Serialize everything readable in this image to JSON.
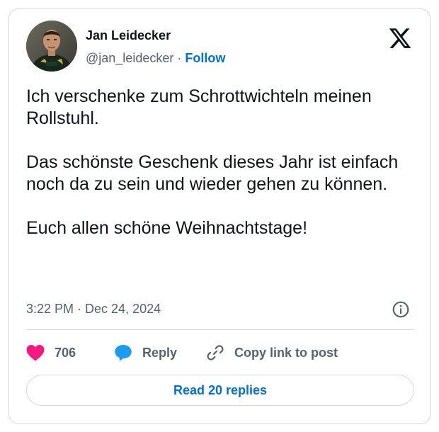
{
  "author": {
    "name": "Jan Leidecker",
    "handle": "@jan_leidecker",
    "separator": "·",
    "follow_label": "Follow"
  },
  "icons": {
    "brand": "x-logo-icon",
    "info": "info-icon",
    "like": "heart-icon",
    "reply": "speech-bubble-icon",
    "copy": "link-icon"
  },
  "tweet": {
    "paragraphs": [
      "Ich verschenke zum Schrottwichteln meinen Rollstuhl.",
      "Das schönste Geschenk dieses Jahr ist einfach noch da zu sein und wieder gehen zu können.",
      "Euch allen schöne Weihnachtstage!"
    ],
    "timestamp": "3:22 PM · Dec 24, 2024"
  },
  "actions": {
    "like_count": "706",
    "reply_label": "Reply",
    "copy_label": "Copy link to post"
  },
  "footer": {
    "read_replies_label": "Read 20 replies"
  },
  "colors": {
    "link_blue": "#006fd6",
    "heart_pink": "#f91880",
    "reply_blue": "#1d9bf0",
    "muted_text": "#536471",
    "border": "#cfd9de"
  }
}
